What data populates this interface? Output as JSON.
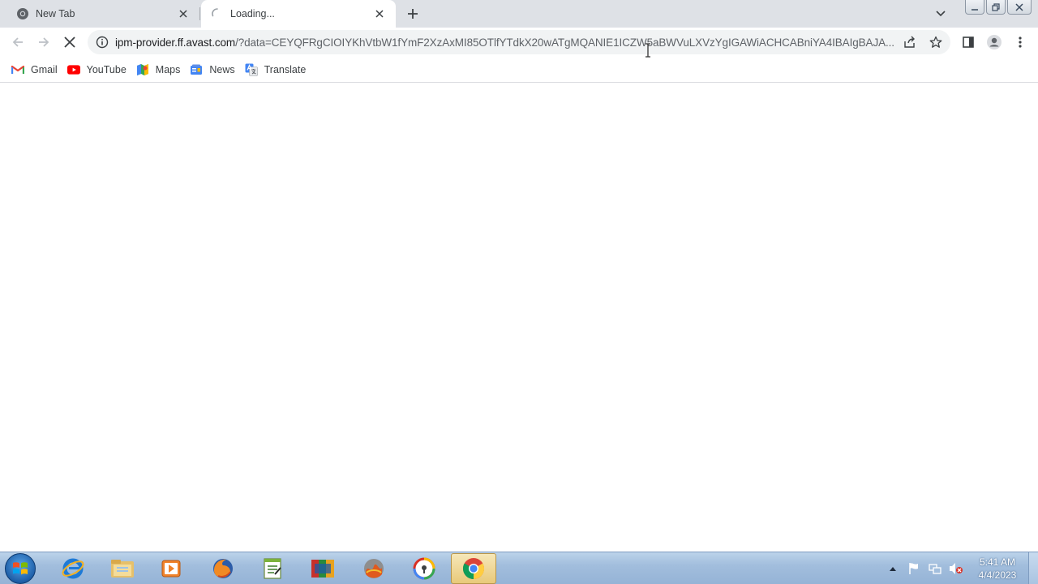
{
  "tabs": [
    {
      "title": "New Tab",
      "icon": "chrome-icon"
    },
    {
      "title": "Loading...",
      "icon": "loading-spinner-icon"
    }
  ],
  "toolbar": {
    "url_host": "ipm-provider.ff.avast.com",
    "url_rest": "/?data=CEYQFRgCIOIYKhVtbW1fYmF2XzAxMI85OTlfYTdkX20wATgMQANIE1ICZW5aBWVuLXVzYgIGAWiACHCABniYA4IBAIgBAJA..."
  },
  "bookmarks": [
    {
      "label": "Gmail",
      "icon": "gmail-icon"
    },
    {
      "label": "YouTube",
      "icon": "youtube-icon"
    },
    {
      "label": "Maps",
      "icon": "maps-icon"
    },
    {
      "label": "News",
      "icon": "news-icon"
    },
    {
      "label": "Translate",
      "icon": "translate-icon"
    }
  ],
  "taskbar": {
    "apps": [
      "internet-explorer-icon",
      "file-explorer-icon",
      "media-player-icon",
      "firefox-icon",
      "notepad-icon",
      "app-icon",
      "app-icon",
      "app-icon",
      "chrome-icon"
    ],
    "clock_time": "5:41 AM",
    "clock_date": "4/4/2023"
  },
  "colors": {
    "tabstrip": "#dee1e6",
    "omnibox": "#f1f3f4",
    "taskbar": "#a2bedd",
    "text": "#3c4043"
  }
}
